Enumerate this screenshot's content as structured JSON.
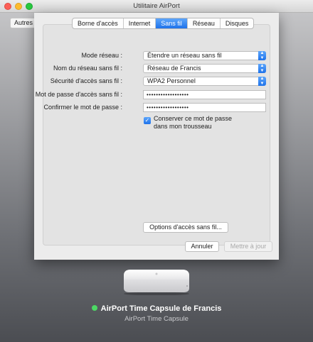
{
  "window": {
    "title": "Utilitaire AirPort"
  },
  "background_button": {
    "label": "Autres"
  },
  "tabs": [
    {
      "label": "Borne d'accès",
      "active": false
    },
    {
      "label": "Internet",
      "active": false
    },
    {
      "label": "Sans fil",
      "active": true
    },
    {
      "label": "Réseau",
      "active": false
    },
    {
      "label": "Disques",
      "active": false
    }
  ],
  "form": {
    "network_mode": {
      "label": "Mode réseau :",
      "value": "Étendre un réseau sans fil"
    },
    "network_name": {
      "label": "Nom du réseau sans fil :",
      "value": "Réseau de Francis"
    },
    "security": {
      "label": "Sécurité d'accès sans fil :",
      "value": "WPA2 Personnel"
    },
    "password": {
      "label": "Mot de passe d'accès sans fil :",
      "value": "••••••••••••••••••"
    },
    "confirm_password": {
      "label": "Confirmer le mot de passe :",
      "value": "••••••••••••••••••"
    },
    "keychain": {
      "label": "Conserver ce mot de passe dans mon trousseau",
      "checked": true
    },
    "options_button": "Options d'accès sans fil..."
  },
  "footer": {
    "cancel_label": "Annuler",
    "update_label": "Mettre à jour",
    "update_enabled": false
  },
  "device": {
    "name": "AirPort Time Capsule de Francis",
    "model": "AirPort Time Capsule",
    "status_color": "#4cd964",
    "icon": "time-capsule-icon"
  },
  "colors": {
    "accent": "#1e72ea"
  }
}
